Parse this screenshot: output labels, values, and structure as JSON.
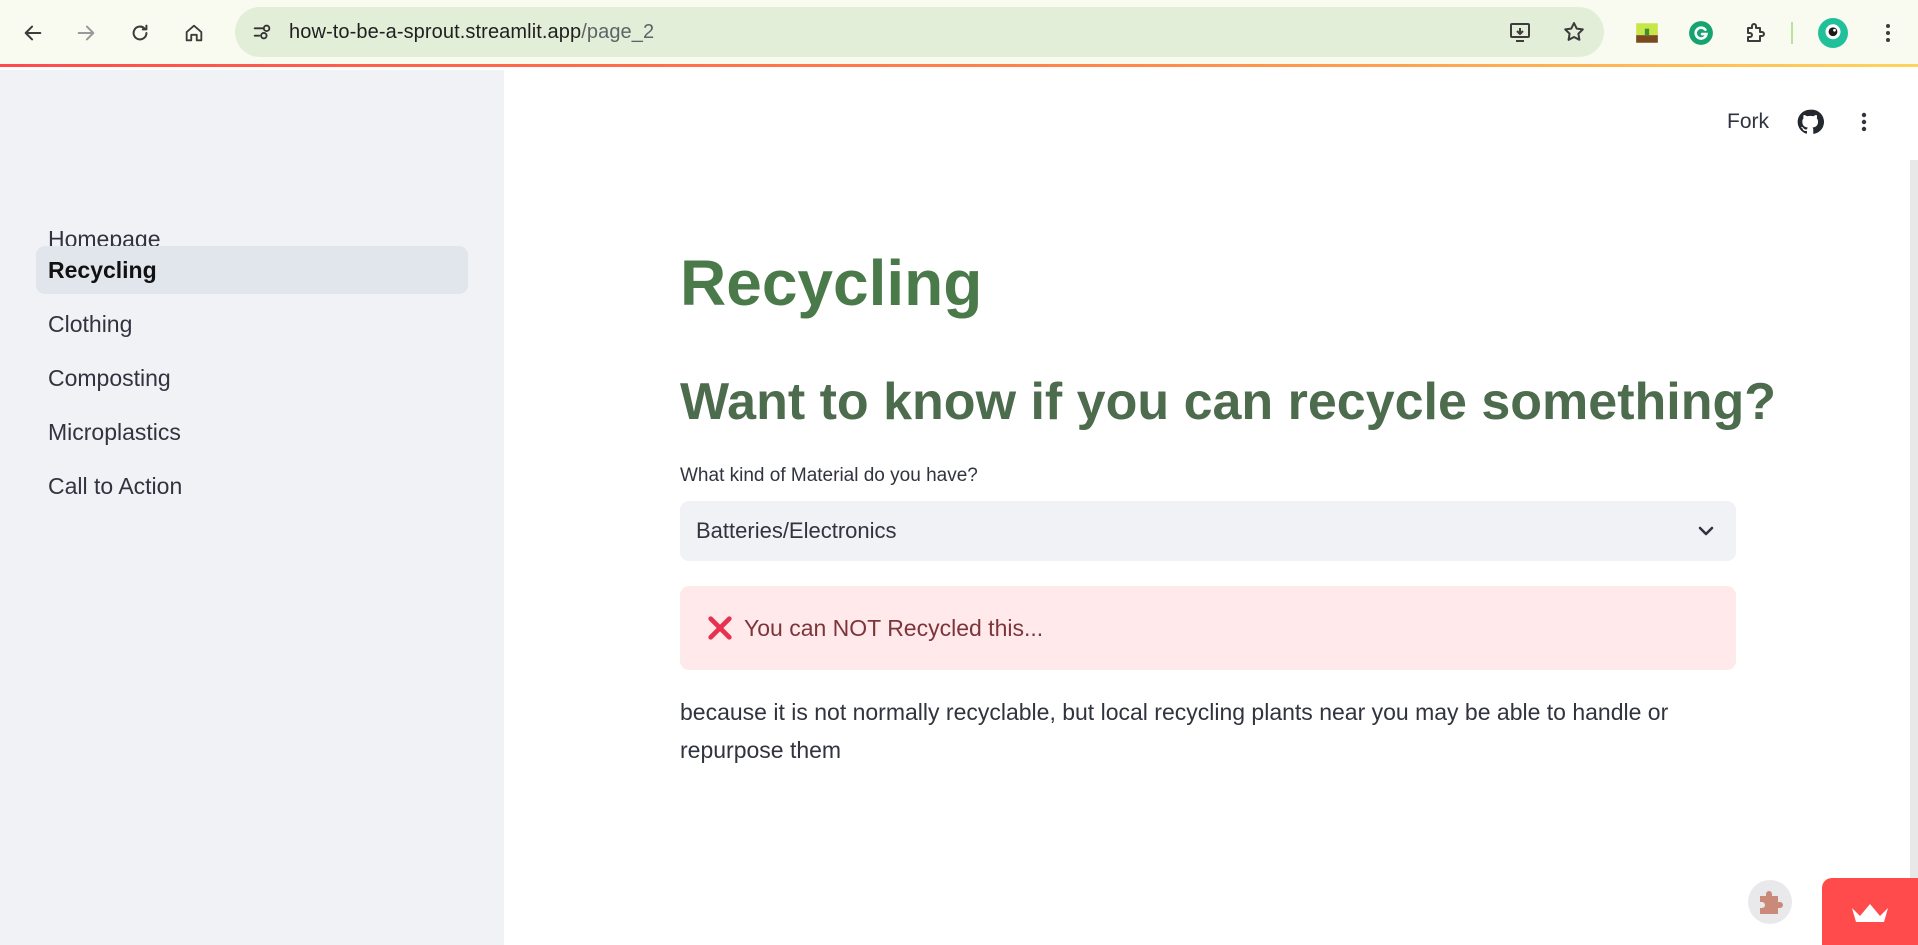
{
  "browser": {
    "url_host": "how-to-be-a-sprout.streamlit.app",
    "url_path": "/page_2",
    "icons": [
      "back-icon",
      "forward-icon",
      "reload-icon",
      "home-icon",
      "site-info-icon",
      "install-app-icon",
      "bookmark-star-icon",
      "extension-sprout-icon",
      "grammarly-icon",
      "extensions-puzzle-icon",
      "profile-avatar-icon",
      "chrome-menu-icon"
    ],
    "accent": "#e3eed8"
  },
  "sidebar": {
    "items": [
      {
        "label": "Homepage",
        "active": false
      },
      {
        "label": "Recycling",
        "active": true
      },
      {
        "label": "Clothing",
        "active": false
      },
      {
        "label": "Composting",
        "active": false
      },
      {
        "label": "Microplastics",
        "active": false
      },
      {
        "label": "Call to Action",
        "active": false
      }
    ]
  },
  "toolbar": {
    "fork_label": "Fork",
    "icons": [
      "github-icon",
      "more-vertical-icon"
    ]
  },
  "main": {
    "title": "Recycling",
    "subheader": "Want to know if you can recycle something?",
    "select": {
      "label": "What kind of Material do you have?",
      "value": "Batteries/Electronics"
    },
    "alert": {
      "text": "You can NOT Recycled this...",
      "icon": "cross-mark-icon",
      "color": "#ffe9ea"
    },
    "body": "because it is not normally recyclable, but local recycling plants near you may be able to handle or repurpose them"
  },
  "colors": {
    "title": "#4a7a4a",
    "subheader": "#4d6b4d",
    "streamlit_red": "#ff4b4b"
  }
}
